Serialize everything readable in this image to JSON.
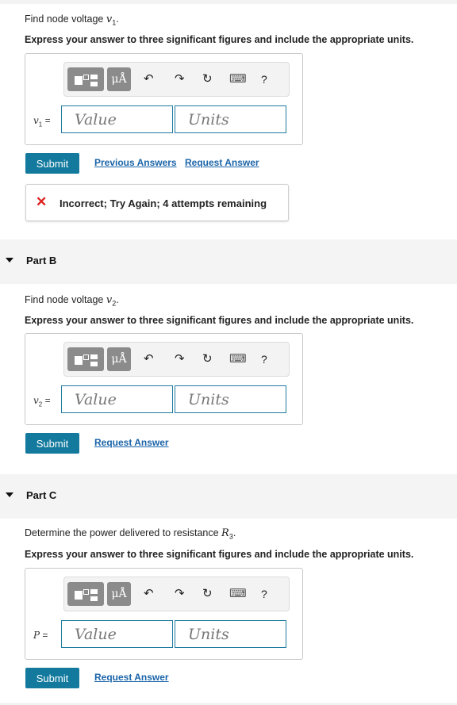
{
  "part_a": {
    "question": "Find node voltage ",
    "question_var": "v",
    "question_sub": "1",
    "question_end": ".",
    "instruction": "Express your answer to three significant figures and include the appropriate units.",
    "label_var": "v",
    "label_sub": "1",
    "label_eq": " =",
    "value_placeholder": "Value",
    "units_placeholder": "Units",
    "submit_label": "Submit",
    "previous_answers_label": "Previous Answers",
    "request_answer_label": "Request Answer",
    "feedback_message": "Incorrect; Try Again; 4 attempts remaining"
  },
  "part_b": {
    "title": "Part B",
    "question": "Find node voltage ",
    "question_var": "v",
    "question_sub": "2",
    "question_end": ".",
    "instruction": "Express your answer to three significant figures and include the appropriate units.",
    "label_var": "v",
    "label_sub": "2",
    "label_eq": " =",
    "value_placeholder": "Value",
    "units_placeholder": "Units",
    "submit_label": "Submit",
    "request_answer_label": "Request Answer"
  },
  "part_c": {
    "title": "Part C",
    "question": "Determine the power delivered to resistance ",
    "question_var": "R",
    "question_sub": "3",
    "question_end": ".",
    "instruction": "Express your answer to three significant figures and include the appropriate units.",
    "label_var": "P",
    "label_eq": " =",
    "value_placeholder": "Value",
    "units_placeholder": "Units",
    "submit_label": "Submit",
    "request_answer_label": "Request Answer"
  },
  "toolbar": {
    "units_label": "μÅ",
    "undo_glyph": "↶",
    "redo_glyph": "↷",
    "reset_glyph": "↻",
    "keyboard_glyph": "⌨",
    "help_label": "?",
    "icons": [
      "templates-icon",
      "units-icon",
      "undo-icon",
      "redo-icon",
      "reset-icon",
      "keyboard-icon",
      "help-icon"
    ]
  },
  "colors": {
    "submit": "#137a9e",
    "link": "#1a64a8",
    "incorrect": "#dd2222",
    "field_border": "#1f7ba0"
  }
}
